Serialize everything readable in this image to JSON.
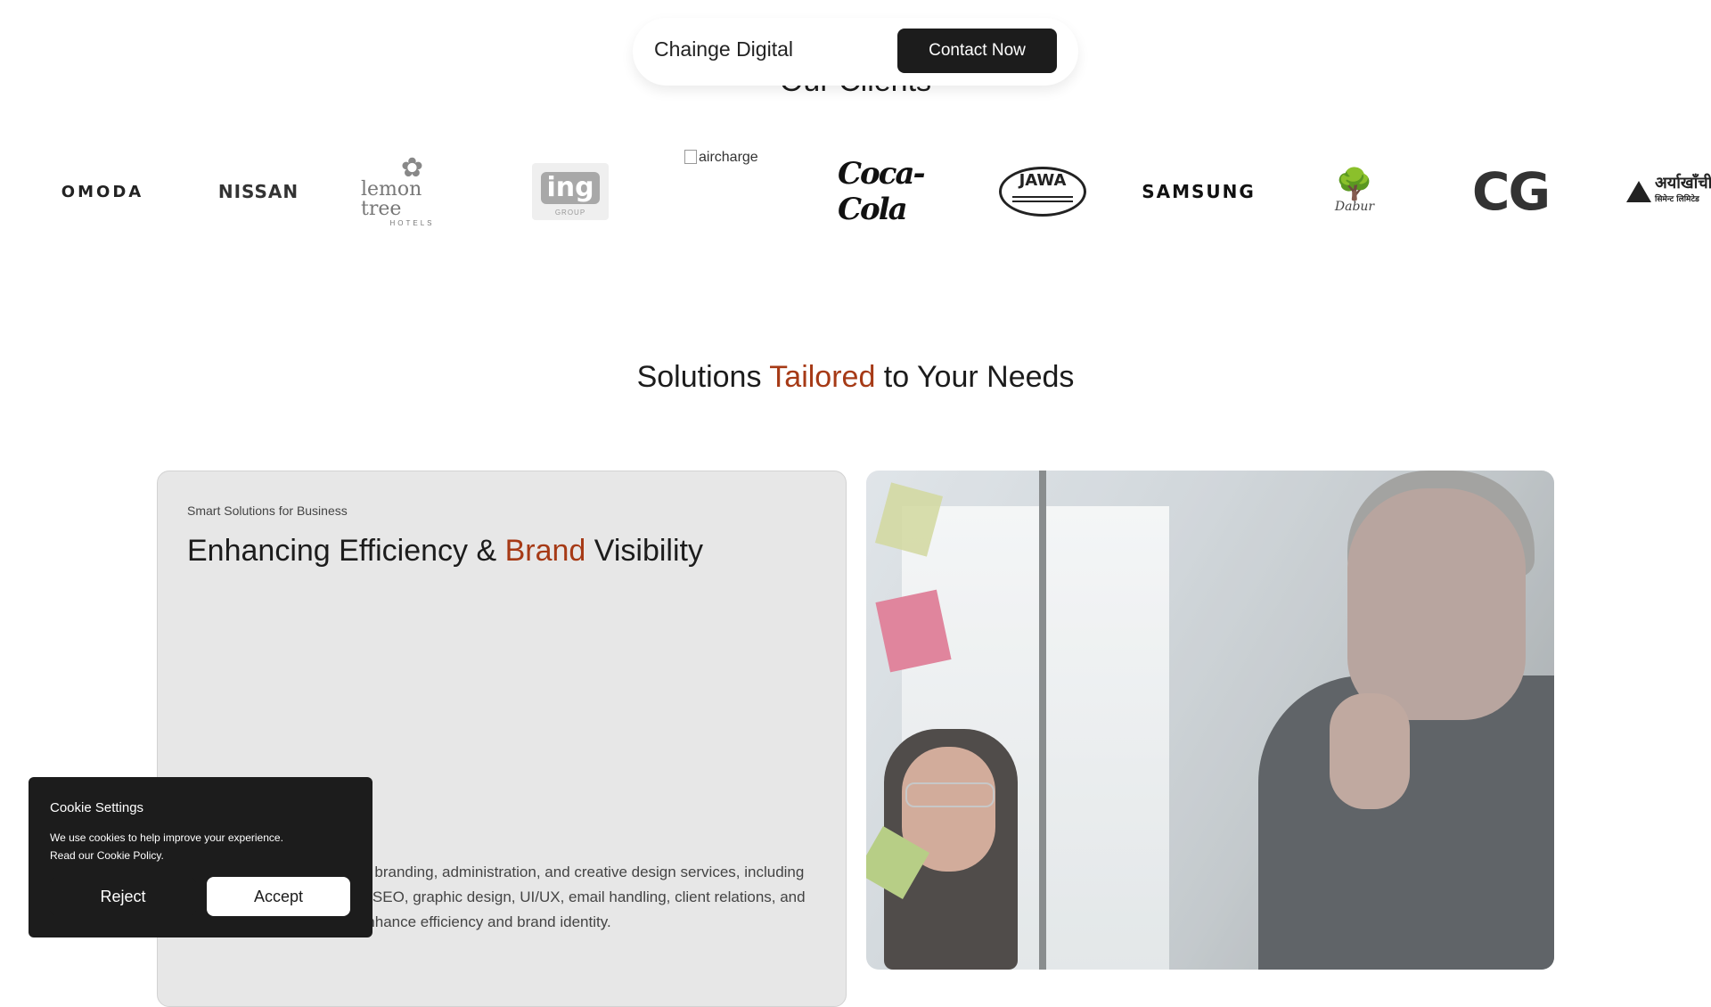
{
  "header": {
    "brand": "Chainge Digital",
    "contact_label": "Contact Now"
  },
  "clients": {
    "title": "Our Clients",
    "logos": [
      {
        "name": "OMODA",
        "text": "OMODA"
      },
      {
        "name": "NISSAN",
        "text": "NISSAN"
      },
      {
        "name": "lemon tree hotels",
        "text": "lemon tree",
        "sub": "HOTELS"
      },
      {
        "name": "ing group",
        "text": "ing",
        "sub": "GROUP"
      },
      {
        "name": "aircharge",
        "text": "aircharge"
      },
      {
        "name": "Coca-Cola",
        "text": "Coca-Cola"
      },
      {
        "name": "JAWA",
        "text": "JAWA"
      },
      {
        "name": "SAMSUNG",
        "text": "SAMSUNG"
      },
      {
        "name": "Dabur",
        "text": "Dabur"
      },
      {
        "name": "CG",
        "text": "CG"
      },
      {
        "name": "Aryakhachi",
        "text": "अर्याखाँची",
        "sub": "सिमेन्ट लिमिटेड"
      }
    ]
  },
  "solutions": {
    "title_before": "Solutions ",
    "title_accent": "Tailored",
    "title_after": " to Your Needs"
  },
  "card": {
    "kicker": "Smart Solutions for Business",
    "title_before": "Enhancing Efficiency & ",
    "title_accent": "Brand",
    "title_after": " Visibility",
    "body": "We provide comprehensive branding, administration, and creative design services, including social media management, SEO, graphic design, UI/UX, email handling, client relations, and daily business support to enhance efficiency and brand identity."
  },
  "cookie": {
    "title": "Cookie Settings",
    "text_line1": "We use cookies to help improve your experience.",
    "text_line2": "Read our Cookie Policy.",
    "reject_label": "Reject",
    "accept_label": "Accept"
  },
  "colors": {
    "accent": "#a63a16",
    "dark": "#1c1c1c",
    "card_bg": "#e7e7e7"
  }
}
